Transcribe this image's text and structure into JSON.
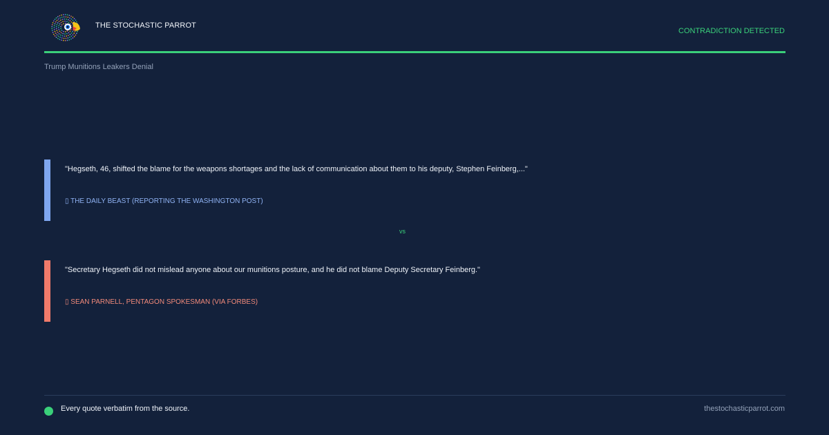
{
  "header": {
    "brand": "THE STOCHASTIC PARROT",
    "status": "CONTRADICTION DETECTED",
    "topic": "Trump Munitions Leakers Denial"
  },
  "quotes": [
    {
      "text": "\"Hegseth, 46, shifted the blame for the weapons shortages and the lack of communication about them to his deputy, Stephen Feinberg,...\"",
      "attribution": "▯ THE DAILY BEAST (REPORTING THE WASHINGTON POST)",
      "color": "#7ea6ef"
    },
    {
      "text": "\"Secretary Hegseth did not mislead anyone about our munitions posture, and he did not blame Deputy Secretary Feinberg.\"",
      "attribution": "▯ SEAN PARNELL, PENTAGON SPOKESMAN (VIA FORBES)",
      "color": "#f07a6a"
    }
  ],
  "divider": {
    "label": "vs"
  },
  "footer": {
    "note": "Every quote verbatim from the source.",
    "site": "thestochasticparrot.com"
  },
  "colors": {
    "background": "#13213b",
    "accent": "#3ad07a"
  },
  "icons": {
    "logo": "parrot-logo-icon",
    "footer_dot": "status-dot-icon"
  }
}
